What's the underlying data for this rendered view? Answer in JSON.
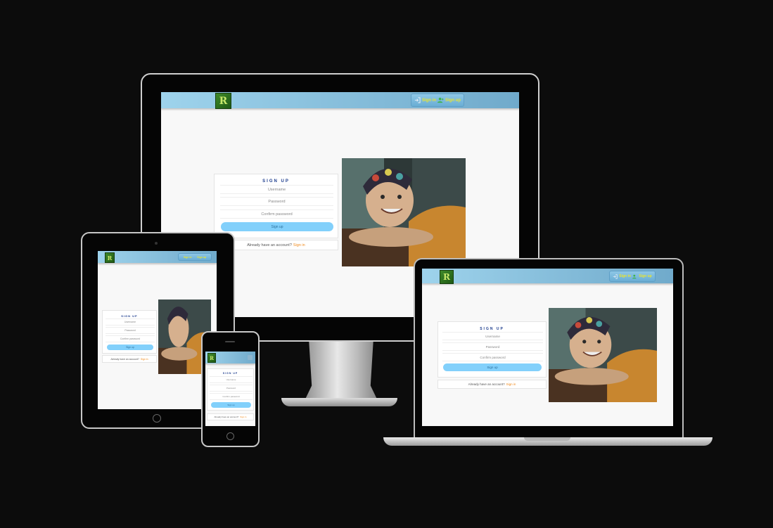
{
  "app": {
    "logo_text": "R",
    "nav": {
      "signin": "Sign in",
      "signup": "Sign up"
    },
    "form": {
      "title": "SIGN UP",
      "username_placeholder": "Username",
      "password_placeholder": "Password",
      "confirm_placeholder": "Confirm password",
      "submit": "Sign up"
    },
    "alt": {
      "text": "Already have an account?",
      "link": "Sign in"
    }
  },
  "colors": {
    "header": "#8fc5e2",
    "nav_text": "#e9e430",
    "button": "#82d0fb",
    "link": "#f08a1c",
    "title": "#1a3a8c"
  },
  "icons": {
    "signin": "signin-icon",
    "signup": "user-add-icon",
    "logo": "logo-icon"
  }
}
